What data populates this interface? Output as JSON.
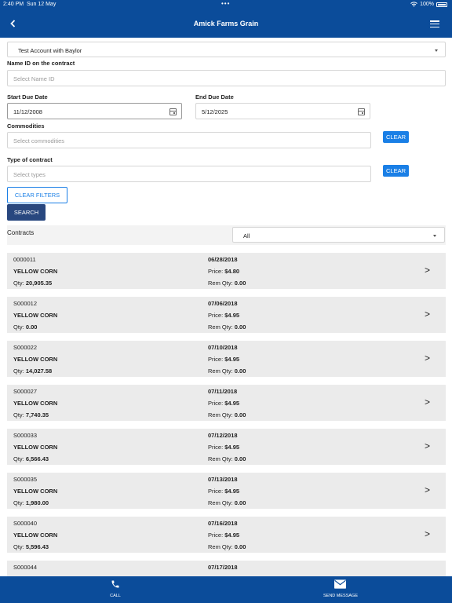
{
  "status_bar": {
    "time": "2:40 PM",
    "date": "Sun 12 May",
    "dots": "•••",
    "battery": "100%"
  },
  "nav": {
    "title": "Amick Farms Grain"
  },
  "account": {
    "value": "Test Account with Baylor"
  },
  "name_id": {
    "label": "Name ID on the contract",
    "placeholder": "Select Name ID"
  },
  "start_due": {
    "label": "Start Due Date",
    "value": "11/12/2008"
  },
  "end_due": {
    "label": "End Due Date",
    "value": "5/12/2025"
  },
  "commodities": {
    "label": "Commodities",
    "placeholder": "Select commodities",
    "clear": "CLEAR"
  },
  "contract_type": {
    "label": "Type of contract",
    "placeholder": "Select types",
    "clear": "CLEAR"
  },
  "buttons": {
    "clear_filters": "CLEAR FILTERS",
    "search": "SEARCH"
  },
  "contracts_header": {
    "label": "Contracts",
    "filter": "All"
  },
  "labels": {
    "price": "Price: ",
    "qty": "Qty: ",
    "rem_qty": "Rem Qty: "
  },
  "contracts": [
    {
      "id": "0000011",
      "commodity": "YELLOW CORN",
      "qty": "20,905.35",
      "date": "06/28/2018",
      "price": "$4.80",
      "rem_qty": "0.00"
    },
    {
      "id": "S000012",
      "commodity": "YELLOW CORN",
      "qty": "0.00",
      "date": "07/06/2018",
      "price": "$4.95",
      "rem_qty": "0.00"
    },
    {
      "id": "S000022",
      "commodity": "YELLOW CORN",
      "qty": "14,027.58",
      "date": "07/10/2018",
      "price": "$4.95",
      "rem_qty": "0.00"
    },
    {
      "id": "S000027",
      "commodity": "YELLOW CORN",
      "qty": "7,740.35",
      "date": "07/11/2018",
      "price": "$4.95",
      "rem_qty": "0.00"
    },
    {
      "id": "S000033",
      "commodity": "YELLOW CORN",
      "qty": "6,566.43",
      "date": "07/12/2018",
      "price": "$4.95",
      "rem_qty": "0.00"
    },
    {
      "id": "S000035",
      "commodity": "YELLOW CORN",
      "qty": "1,980.00",
      "date": "07/13/2018",
      "price": "$4.95",
      "rem_qty": "0.00"
    },
    {
      "id": "S000040",
      "commodity": "YELLOW CORN",
      "qty": "5,596.43",
      "date": "07/16/2018",
      "price": "$4.95",
      "rem_qty": "0.00"
    },
    {
      "id": "S000044",
      "commodity": "",
      "qty": "",
      "date": "07/17/2018",
      "price": "",
      "rem_qty": ""
    }
  ],
  "tabs": {
    "call": "CALL",
    "send_message": "SEND MESSAGE"
  },
  "colors": {
    "brand": "#0b4c9a",
    "accent": "#1a7fe6",
    "search": "#28477f",
    "card": "#ebebeb"
  },
  "icons": {
    "back": "chevron-left-icon",
    "menu": "hamburger-menu-icon",
    "calendar": "calendar-icon",
    "row": "chevron-right-icon",
    "call": "phone-icon",
    "message": "envelope-icon"
  }
}
